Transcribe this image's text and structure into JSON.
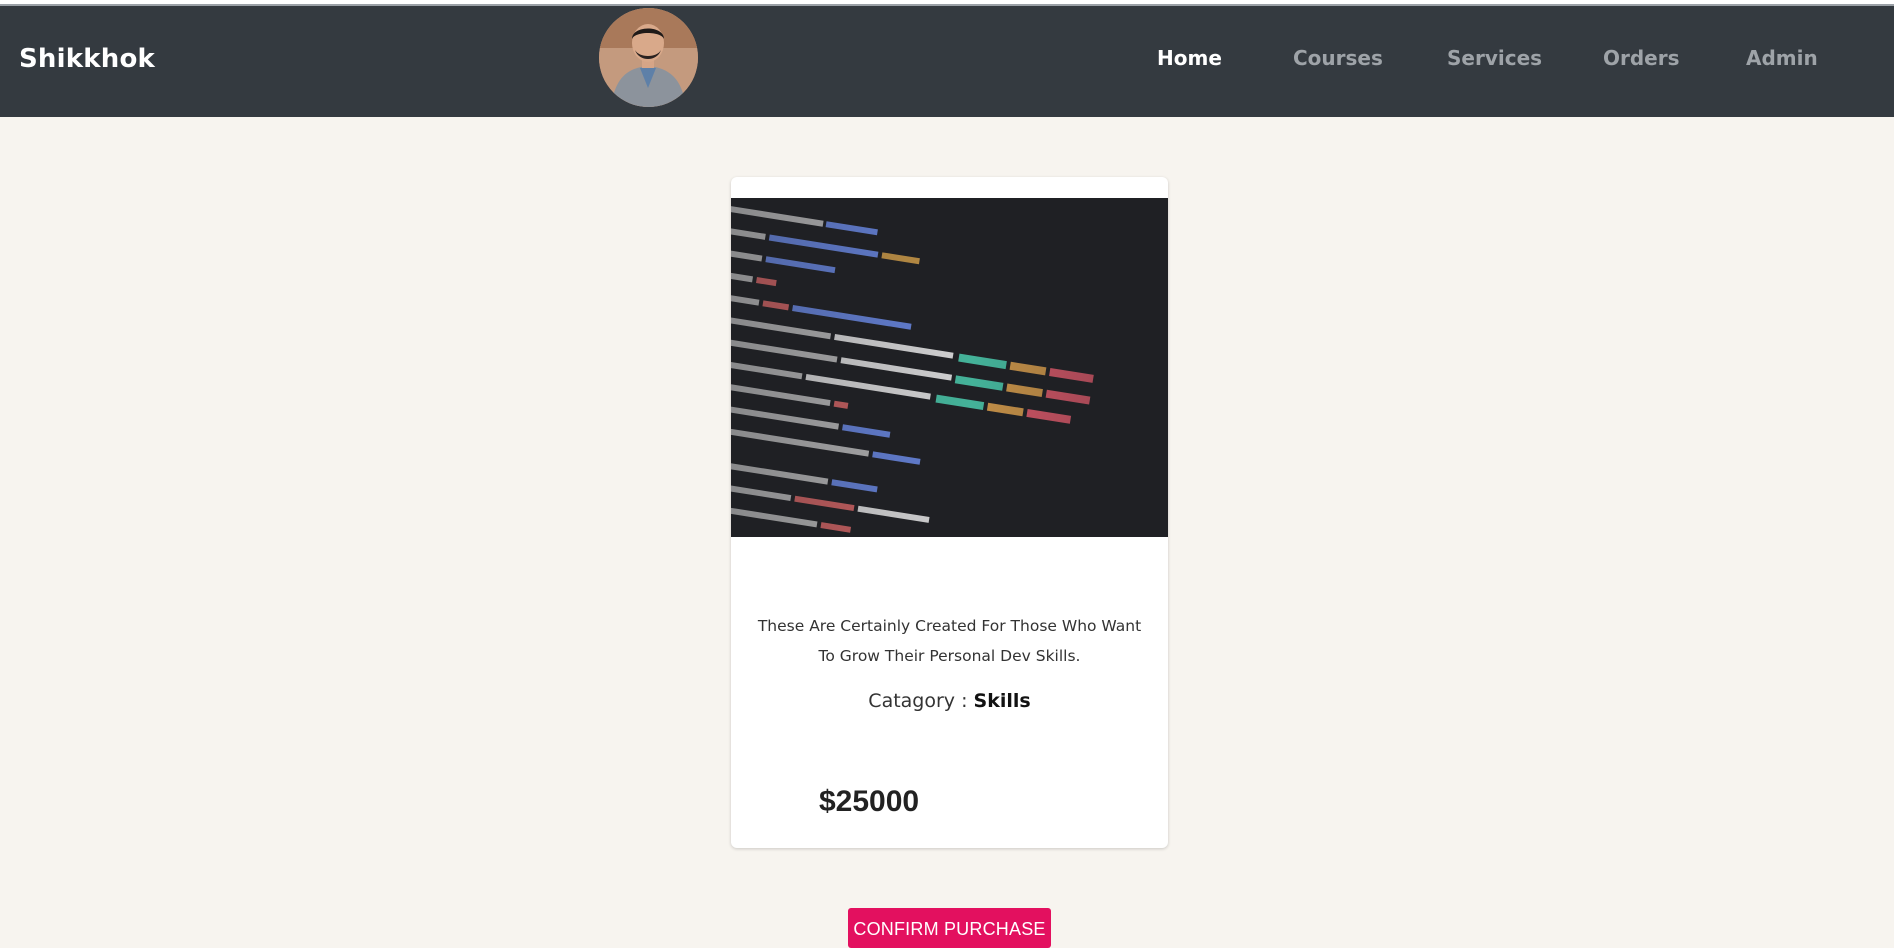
{
  "navbar": {
    "brand": "Shikkhok",
    "links": [
      {
        "label": "Home",
        "active": true
      },
      {
        "label": "Courses",
        "active": false
      },
      {
        "label": "Services",
        "active": false
      },
      {
        "label": "Orders",
        "active": false
      },
      {
        "label": "Admin",
        "active": false
      }
    ]
  },
  "course": {
    "description": "These Are Certainly Created For Those Who Want To Grow Their Personal Dev Skills.",
    "category_label": "Catagory : ",
    "category_value": "Skills",
    "price": "$25000"
  },
  "actions": {
    "confirm_label": "CONFIRM PURCHASE"
  },
  "colors": {
    "navbar_bg": "#343a40",
    "page_bg": "#f7f4ef",
    "accent": "#e3105f"
  }
}
